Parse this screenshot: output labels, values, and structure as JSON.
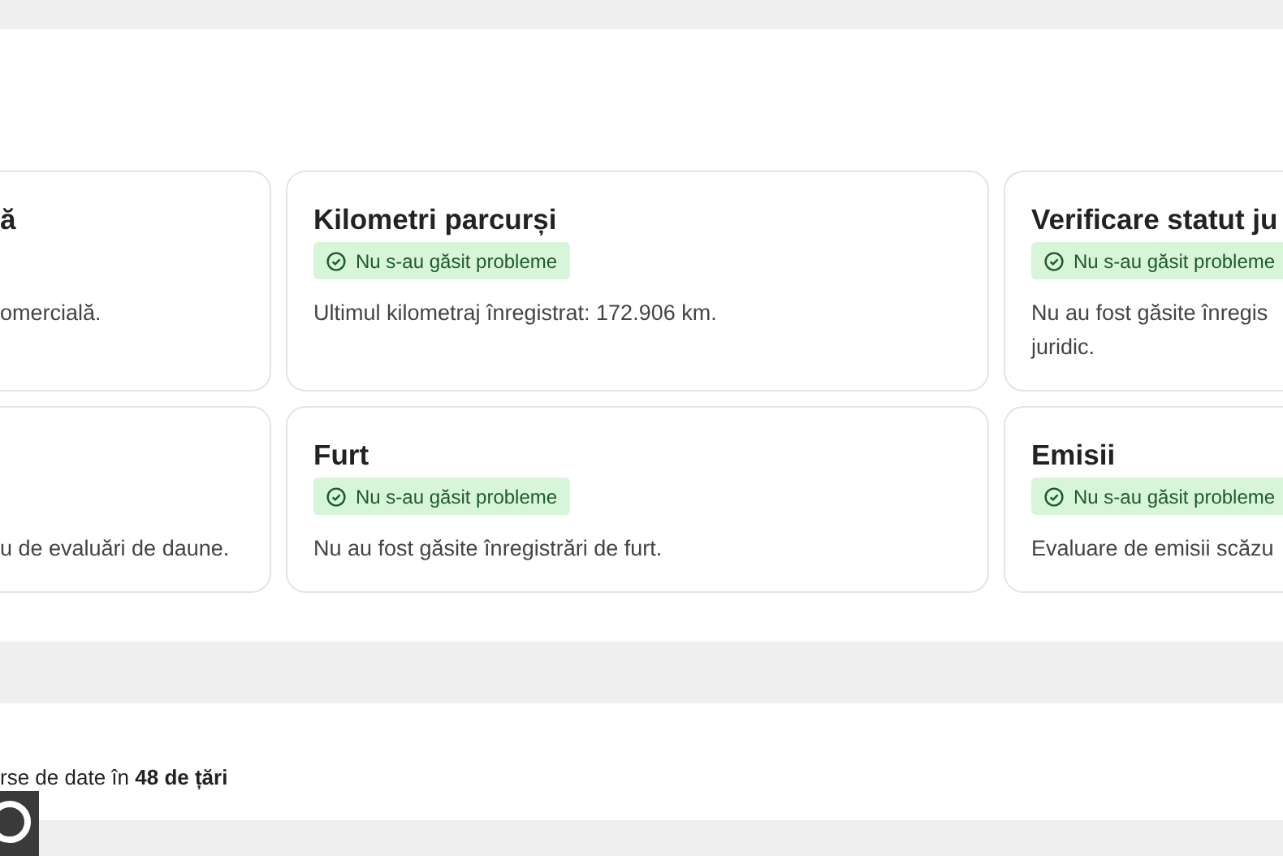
{
  "rows": [
    {
      "cards": [
        {
          "title": "ă",
          "description_lines": [
            "omercială."
          ]
        },
        {
          "title": "Kilometri parcurși",
          "badge": {
            "text": "Nu s-au găsit probleme",
            "passed": true
          },
          "description_lines": [
            "Ultimul kilometraj înregistrat: 172.906 km."
          ]
        },
        {
          "title": "Verificare statut ju",
          "badge": {
            "text": "Nu s-au găsit probleme",
            "passed": true
          },
          "description_lines": [
            "Nu au fost găsite înregis",
            "juridic."
          ]
        }
      ]
    },
    {
      "cards": [
        {
          "description_lines": [
            "u de evaluări de daune."
          ]
        },
        {
          "title": "Furt",
          "badge": {
            "text": "Nu s-au găsit probleme",
            "passed": true
          },
          "description_lines": [
            "Nu au fost găsite înregistrări de furt."
          ]
        },
        {
          "title": "Emisii",
          "badge": {
            "text": "Nu s-au găsit probleme",
            "passed": true
          },
          "description_lines": [
            "Evaluare de emisii scăzu"
          ]
        }
      ]
    }
  ],
  "footer": {
    "text": "rse de date în **48 de țări**"
  }
}
